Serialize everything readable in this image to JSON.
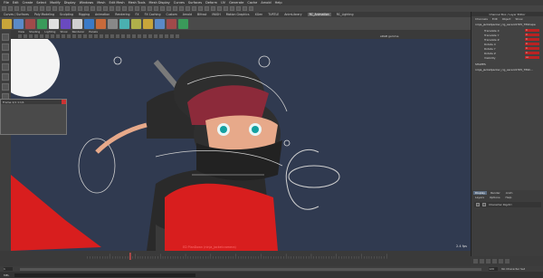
{
  "menubar": {
    "items": [
      "File",
      "Edit",
      "Create",
      "Select",
      "Modify",
      "Display",
      "Windows",
      "Mesh",
      "Edit Mesh",
      "Mesh Tools",
      "Mesh Display",
      "Curves",
      "Surfaces",
      "Deform",
      "UV",
      "Generate",
      "Cache",
      "Arnold",
      "Help"
    ]
  },
  "shelf": {
    "tabs": [
      "Curves / Surfaces",
      "Poly Modeling",
      "Sculpting",
      "Rigging",
      "Animation",
      "Rendering",
      "FX",
      "FX Caching",
      "Custom",
      "Arnold",
      "Bifrost",
      "MASH",
      "Motion Graphics",
      "XGen",
      "TURTLE",
      "AnimLibrary",
      "RC_Animation",
      "RC_Lighting"
    ],
    "active_tab": "RC_Animation"
  },
  "viewport": {
    "menu": [
      "View",
      "Shading",
      "Lighting",
      "Show",
      "Renderer",
      "Panels"
    ],
    "camera_label": "sRGB gamma",
    "hud_camera": "ED PlanDown (ninja_jacket:camera)",
    "fps": "2.4 fps"
  },
  "floating_window": {
    "title": "Frame 1/1 1:1/1"
  },
  "channel_box": {
    "title": "Channel Box / Layer Editor",
    "tabs": [
      "Channels",
      "Edit",
      "Object",
      "Show"
    ],
    "object_name": "ninja_jacketpacker_rig_ascenl1765_T6Shape",
    "attributes": [
      {
        "name": "Translate X",
        "value": "0"
      },
      {
        "name": "Translate Y",
        "value": "0"
      },
      {
        "name": "Translate Z",
        "value": "0"
      },
      {
        "name": "Rotate X",
        "value": "0"
      },
      {
        "name": "Rotate Y",
        "value": "0"
      },
      {
        "name": "Rotate Z",
        "value": "0"
      },
      {
        "name": "Visibility",
        "value": "on"
      }
    ],
    "shapes_label": "SHAPES",
    "shape_name": "ninja_jacketpacker_rig_ascenl1765_T6Sh..."
  },
  "layers": {
    "tabs": [
      "Display",
      "Render",
      "Anim"
    ],
    "menu": [
      "Layers",
      "Options",
      "Help"
    ],
    "layer_name": "Character Rigctrl"
  },
  "timeline": {
    "start": "1",
    "end": "120",
    "current": "18"
  },
  "status": {
    "mel": "MEL",
    "no_char": "No Character Set"
  },
  "colors": {
    "viewport_bg": "#303a50",
    "accent": "#e05050",
    "jacket_red": "#d81e1e"
  }
}
